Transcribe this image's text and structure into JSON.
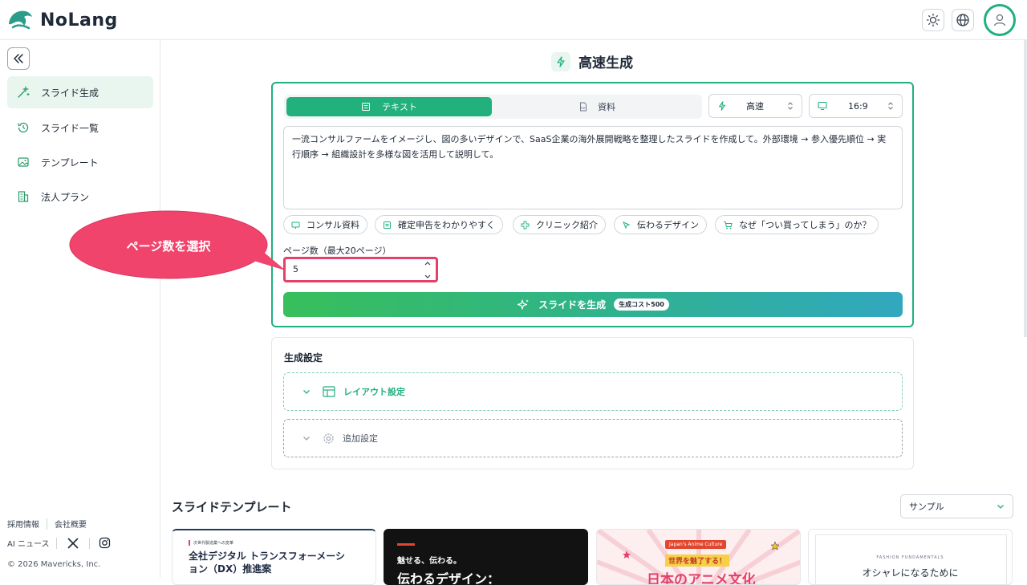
{
  "app": {
    "name": "NoLang"
  },
  "sidebar": {
    "items": [
      {
        "label": "スライド生成",
        "icon": "magic-wand-icon",
        "active": true
      },
      {
        "label": "スライド一覧",
        "icon": "history-icon",
        "active": false
      },
      {
        "label": "テンプレート",
        "icon": "image-icon",
        "active": false
      },
      {
        "label": "法人プラン",
        "icon": "building-icon",
        "active": false
      }
    ],
    "footer": {
      "links": [
        "採用情報",
        "会社概要"
      ],
      "ai_news": "AI ニュース",
      "copyright": "© 2026 Mavericks, Inc."
    }
  },
  "main": {
    "title": "高速生成",
    "tabs": [
      {
        "label": "テキスト",
        "active": true
      },
      {
        "label": "資料",
        "active": false
      }
    ],
    "speed_select": {
      "value": "高速"
    },
    "ratio_select": {
      "value": "16:9"
    },
    "prompt_text": "一流コンサルファームをイメージし、図の多いデザインで、SaaS企業の海外展開戦略を整理したスライドを作成して。外部環境 → 参入優先順位 → 実行順序 → 組織設計を多様な図を活用して説明して。",
    "chips": [
      {
        "label": "コンサル資料"
      },
      {
        "label": "確定申告をわかりやすく"
      },
      {
        "label": "クリニック紹介"
      },
      {
        "label": "伝わるデザイン"
      },
      {
        "label": "なぜ「つい買ってしまう」のか？"
      }
    ],
    "pages": {
      "label": "ページ数（最大20ページ）",
      "value": "5"
    },
    "generate_button": {
      "label": "スライドを生成",
      "cost": "生成コスト500"
    },
    "settings": {
      "title": "生成設定",
      "layout": "レイアウト設定",
      "additional": "追加設定"
    },
    "templates": {
      "title": "スライドテンプレート",
      "filter": "サンプル",
      "cards": [
        {
          "tag": "次世代製造業への変革",
          "title": "全社デジタル トランスフォーメーション（DX）推進案"
        },
        {
          "subtitle": "魅せる、伝わる。",
          "title": "伝わるデザイン："
        },
        {
          "tag": "Japan's Anime Culture",
          "subtitle": "世界を魅了する！",
          "title": "日本のアニメ文化"
        },
        {
          "tag": "FASHION FUNDAMENTALS",
          "title": "オシャレになるために"
        }
      ]
    }
  },
  "callout": {
    "text": "ページ数を選択"
  },
  "colors": {
    "accent": "#22b07d",
    "highlight": "#e4406a"
  }
}
